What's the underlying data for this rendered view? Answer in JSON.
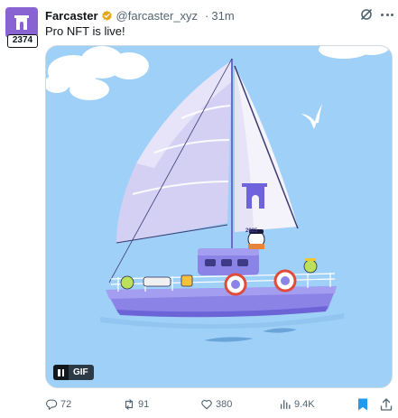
{
  "post": {
    "author_name": "Farcaster",
    "handle": "@farcaster_xyz",
    "separator": "·",
    "time": "31m",
    "avatar_badge": "2374",
    "text": "Pro NFT is live!",
    "media": {
      "type": "GIF",
      "gif_label": "GIF",
      "year_on_hull": "2025"
    },
    "actions": {
      "replies": "72",
      "reposts": "91",
      "likes": "380",
      "views": "9.4K"
    },
    "icons": [
      "verified-icon",
      "grok-icon",
      "more-icon",
      "reply-icon",
      "repost-icon",
      "like-icon",
      "views-icon",
      "bookmark-icon",
      "share-icon",
      "pause-icon"
    ],
    "colors": {
      "brand": "#8a63d2",
      "verified": "#e8a617",
      "bookmarked": "#1d9bf0",
      "muted_text": "#536471",
      "sky": "#9fd0f7",
      "hull": "#8b83e6"
    }
  }
}
